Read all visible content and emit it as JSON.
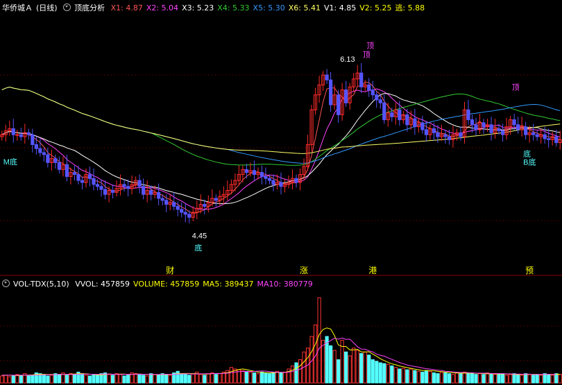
{
  "header_main": {
    "security": "华侨城Ａ",
    "period": "(日线)",
    "indicator": "顶底分析",
    "items": [
      {
        "label": "X1: 4.87",
        "color": "#ff5555"
      },
      {
        "label": "X2: 5.04",
        "color": "#ff44ff"
      },
      {
        "label": "X3: 5.23",
        "color": "#ffffff"
      },
      {
        "label": "X4: 5.33",
        "color": "#33cc33"
      },
      {
        "label": "X5: 5.30",
        "color": "#3399ff"
      },
      {
        "label": "X6: 5.41",
        "color": "#ffff66"
      },
      {
        "label": "V1: 4.85",
        "color": "#ffffff"
      },
      {
        "label": "V2: 5.25",
        "color": "#ffff00"
      },
      {
        "label": "逃: 5.88",
        "color": "#ffff00"
      }
    ]
  },
  "header_volume": {
    "indicator": "VOL-TDX(5,10)",
    "items": [
      {
        "label": "VVOL: 457859",
        "color": "#ffffff"
      },
      {
        "label": "VOLUME: 457859",
        "color": "#ffff00"
      },
      {
        "label": "MA5: 389437",
        "color": "#ffff00"
      },
      {
        "label": "MA10: 380779",
        "color": "#ff44ff"
      }
    ]
  },
  "colors": {
    "background": "#000000",
    "up": "#ff2a2a",
    "down": "#5555ff",
    "volume_up": "#ff3333",
    "volume_down": "#55ffff",
    "grid": "#8b0000",
    "x1": "#ff5555",
    "x2": "#ff44ff",
    "x3": "#ffffff",
    "x4": "#33cc33",
    "x5": "#3399ff",
    "x6": "#ffff66",
    "ma5": "#ffff00",
    "ma10": "#ff44ff"
  },
  "chart_data": {
    "type": "candlestick",
    "price_range": [
      3.9,
      6.5
    ],
    "peak_label": "6.13",
    "low_label": "4.45",
    "signals": [
      {
        "text": "M底",
        "index": 0,
        "kind": "bottom"
      },
      {
        "text": "底",
        "index": 50,
        "kind": "bottom"
      },
      {
        "text": "顶",
        "index": 94,
        "kind": "top"
      },
      {
        "text": "顶",
        "index": 95,
        "kind": "top"
      },
      {
        "text": "顶",
        "index": 133,
        "kind": "top"
      },
      {
        "text": "B底",
        "index": 136,
        "kind": "bottom"
      },
      {
        "text": "底",
        "index": 136,
        "kind": "bottom"
      }
    ],
    "markers": [
      {
        "text": "财",
        "index": 44
      },
      {
        "text": "涨",
        "index": 79
      },
      {
        "text": "港",
        "index": 97
      },
      {
        "text": "预",
        "index": 138
      }
    ],
    "close": [
      5.3,
      5.34,
      5.36,
      5.3,
      5.3,
      5.28,
      5.32,
      5.3,
      5.2,
      5.16,
      5.12,
      5.1,
      5.02,
      5.06,
      5.02,
      4.95,
      5.0,
      4.88,
      4.92,
      4.9,
      4.84,
      4.82,
      4.9,
      4.86,
      4.8,
      4.78,
      4.75,
      4.7,
      4.74,
      4.72,
      4.76,
      4.8,
      4.78,
      4.76,
      4.8,
      4.84,
      4.78,
      4.7,
      4.74,
      4.7,
      4.72,
      4.66,
      4.64,
      4.6,
      4.62,
      4.58,
      4.55,
      4.52,
      4.5,
      4.47,
      4.52,
      4.56,
      4.6,
      4.58,
      4.62,
      4.66,
      4.64,
      4.68,
      4.7,
      4.74,
      4.8,
      4.84,
      4.9,
      4.95,
      4.92,
      4.94,
      4.9,
      4.92,
      4.88,
      4.86,
      4.84,
      4.8,
      4.82,
      4.78,
      4.8,
      4.82,
      4.86,
      4.82,
      4.9,
      4.98,
      5.2,
      5.55,
      5.7,
      5.8,
      5.9,
      5.85,
      5.6,
      5.7,
      5.5,
      5.75,
      5.62,
      5.78,
      5.86,
      5.92,
      5.78,
      5.8,
      5.75,
      5.7,
      5.65,
      5.62,
      5.45,
      5.52,
      5.48,
      5.55,
      5.45,
      5.5,
      5.4,
      5.46,
      5.38,
      5.42,
      5.35,
      5.3,
      5.36,
      5.32,
      5.28,
      5.3,
      5.28,
      5.25,
      5.3,
      5.32,
      5.28,
      5.55,
      5.45,
      5.4,
      5.35,
      5.42,
      5.38,
      5.4,
      5.32,
      5.36,
      5.34,
      5.3,
      5.38,
      5.45,
      5.4,
      5.35,
      5.38,
      5.3,
      5.32,
      5.3,
      5.28,
      5.3,
      5.26,
      5.25,
      5.28,
      5.22,
      5.25
    ],
    "volume": [
      9,
      10,
      8,
      9,
      11,
      10,
      12,
      9,
      10,
      13,
      12,
      11,
      9,
      10,
      12,
      11,
      13,
      10,
      12,
      11,
      14,
      12,
      10,
      9,
      11,
      10,
      12,
      13,
      11,
      10,
      12,
      11,
      9,
      10,
      13,
      12,
      11,
      10,
      9,
      12,
      11,
      10,
      12,
      11,
      10,
      13,
      15,
      12,
      11,
      10,
      12,
      14,
      11,
      10,
      12,
      13,
      11,
      12,
      14,
      16,
      20,
      18,
      17,
      16,
      15,
      14,
      13,
      12,
      14,
      13,
      12,
      14,
      15,
      13,
      14,
      18,
      22,
      26,
      30,
      40,
      45,
      60,
      75,
      110,
      55,
      60,
      48,
      42,
      30,
      55,
      40,
      35,
      45,
      42,
      38,
      40,
      36,
      30,
      28,
      26,
      25,
      24,
      22,
      20,
      18,
      19,
      17,
      18,
      16,
      15,
      14,
      16,
      15,
      13,
      12,
      14,
      13,
      12,
      11,
      13,
      12,
      14,
      13,
      12,
      11,
      12,
      11,
      13,
      12,
      11,
      12,
      11,
      10,
      11,
      12,
      11,
      10,
      12,
      11,
      10,
      11,
      10,
      12,
      11,
      10,
      12,
      11
    ],
    "ma5": [
      10,
      10,
      10,
      10,
      9.4,
      9.6,
      10,
      10.2,
      10.4,
      11,
      11.2,
      11,
      11,
      11,
      10.8,
      11,
      11,
      11,
      11.4,
      11.4,
      12,
      12,
      11.8,
      11.2,
      11,
      10.4,
      10.4,
      11,
      11.4,
      11.2,
      11.2,
      11.4,
      11.4,
      11,
      11,
      11.4,
      11.4,
      11.2,
      11,
      11,
      10.8,
      10.8,
      10.8,
      10.8,
      11,
      11.2,
      12,
      12.2,
      12.2,
      12.2,
      12,
      12,
      11.6,
      11.4,
      11.6,
      12,
      12.2,
      12.2,
      12.4,
      13.2,
      14.6,
      16,
      17.4,
      18,
      17.2,
      16,
      15,
      14,
      13.6,
      13.2,
      13.2,
      13,
      13.6,
      13.6,
      13.6,
      14.8,
      16.4,
      19,
      22,
      27.2,
      32.6,
      40.2,
      50,
      62.4,
      69,
      71,
      69.6,
      61,
      49,
      47,
      47,
      42.6,
      42.6,
      43.4,
      40,
      40,
      40.2,
      37.2,
      34.4,
      31.2,
      28.8,
      26.6,
      24.6,
      23.4,
      21.8,
      20.8,
      19.8,
      18.8,
      17.8,
      17,
      16,
      16,
      15.8,
      15.6,
      15,
      14.4,
      14,
      13.8,
      13.2,
      12.8,
      12.6,
      12.8,
      12.6,
      12.6,
      12.4,
      12.4,
      12.2,
      11.8,
      12,
      11.8,
      11.6,
      11.6,
      11.6,
      11.4,
      11,
      10.8,
      11,
      11,
      11,
      11.2,
      11,
      10.8,
      11,
      11,
      11,
      11.2,
      11
    ],
    "ma10": [
      10,
      10,
      10,
      10,
      10,
      10,
      10,
      10,
      10,
      10.2,
      10.4,
      10.4,
      10.6,
      10.6,
      10.7,
      11,
      11,
      11,
      11,
      11,
      11.3,
      11.4,
      11.4,
      11.2,
      11.2,
      11.1,
      11.2,
      11.5,
      11.4,
      11.2,
      11.1,
      11,
      11.1,
      11.2,
      11.1,
      11.1,
      11.3,
      11.2,
      11.1,
      11.2,
      11,
      11,
      11.1,
      11.1,
      11,
      11.2,
      11.4,
      11.6,
      11.7,
      11.7,
      11.5,
      11.5,
      11.8,
      11.9,
      11.9,
      12,
      12.1,
      12.1,
      12.1,
      12.6,
      13.3,
      14,
      14.5,
      14.8,
      14.8,
      14.8,
      14.8,
      15.2,
      15.5,
      15.2,
      14.6,
      14,
      13.8,
      13.8,
      13.6,
      14,
      14.8,
      16.4,
      17.8,
      20.4,
      23,
      28.2,
      34.5,
      44.8,
      48.7,
      51.8,
      54.8,
      57.7,
      56.5,
      58,
      56.2,
      56.5,
      51.8,
      46.7,
      43.6,
      43.5,
      41.4,
      40,
      37.2,
      35.6,
      34.6,
      32.4,
      30.4,
      28.4,
      26.3,
      24.8,
      23.2,
      22.1,
      21.2,
      20.4,
      19.3,
      18.4,
      17.8,
      17.2,
      16.4,
      16,
      15,
      14.7,
      14.2,
      14,
      13.6,
      13.6,
      13.2,
      13.1,
      12.7,
      12.6,
      12.6,
      12.4,
      12.2,
      12.2,
      12.1,
      12.1,
      11.8,
      11.6,
      11.4,
      11.4,
      11.2,
      11.3,
      11.3,
      11,
      10.9,
      11,
      11,
      11,
      11,
      11
    ],
    "volume_range": [
      0,
      120
    ]
  }
}
